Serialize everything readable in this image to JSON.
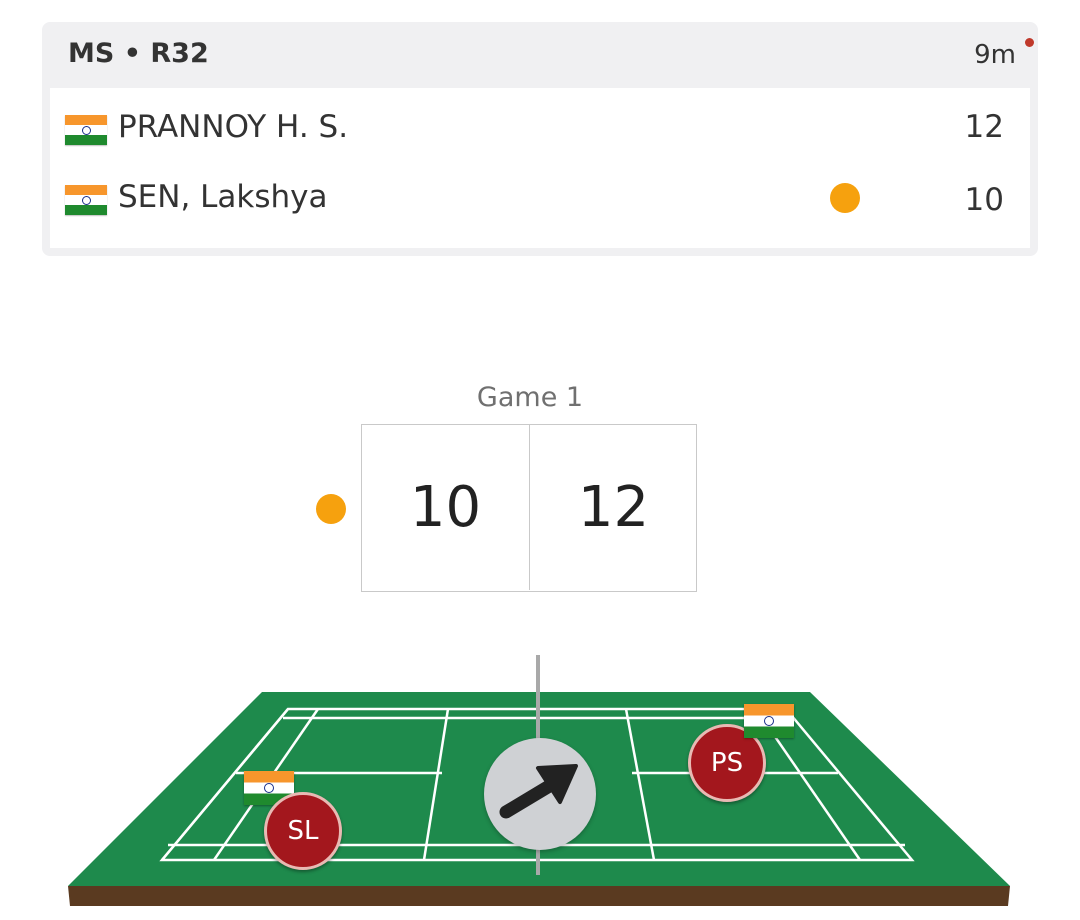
{
  "match": {
    "title": "MS • R32",
    "elapsed": "9m",
    "players": [
      {
        "name": "PRANNOY H. S.",
        "score": "12",
        "country_flag": "india-flag-icon",
        "serving": false
      },
      {
        "name": "SEN, Lakshya",
        "score": "10",
        "country_flag": "india-flag-icon",
        "serving": true
      }
    ]
  },
  "game": {
    "label": "Game 1",
    "left_score": "10",
    "right_score": "12",
    "serving_side": "left"
  },
  "court": {
    "left_player_initials": "SL",
    "right_player_initials": "PS",
    "direction_icon": "arrow-up-right-icon"
  },
  "colors": {
    "court_green": "#1e8a4c",
    "court_base": "#5a3a20",
    "serve_indicator": "#f6a10e",
    "player_disc": "#a3171d",
    "live_dot": "#c0392b"
  }
}
